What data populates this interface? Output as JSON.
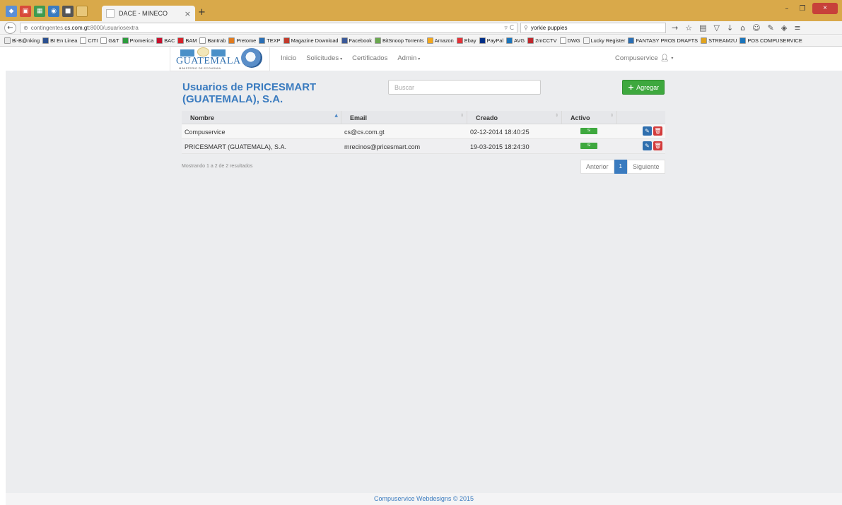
{
  "browser": {
    "tab_title": "DACE - MINECO",
    "tab_close": "×",
    "new_tab": "+",
    "url_prefix": "contingentes.",
    "url_host": "cs.com.gt",
    "url_path": ":8000/usuariosextra",
    "search_value": "yorkie puppies",
    "window_buttons": [
      "–",
      "❐",
      "×"
    ],
    "bookmarks": [
      {
        "label": "Bi-B@nking",
        "color": "#e8e8e8"
      },
      {
        "label": "BI En Linea",
        "color": "#2a4f8f"
      },
      {
        "label": "CITI",
        "color": "#ffffff"
      },
      {
        "label": "G&T",
        "color": "#ffffff"
      },
      {
        "label": "Promerica",
        "color": "#2c9b3c"
      },
      {
        "label": "BAC",
        "color": "#c8102e"
      },
      {
        "label": "BAM",
        "color": "#d6232b"
      },
      {
        "label": "Bantrab",
        "color": "#ffffff"
      },
      {
        "label": "Pretome",
        "color": "#e07b1f"
      },
      {
        "label": "TEXP",
        "color": "#2a6fb5"
      },
      {
        "label": "Magazine Download",
        "color": "#c23a2b"
      },
      {
        "label": "Facebook",
        "color": "#3b5998"
      },
      {
        "label": "BitSnoop Torrents",
        "color": "#6aa84f"
      },
      {
        "label": "Amazon",
        "color": "#f4a81d"
      },
      {
        "label": "Ebay",
        "color": "#e53238"
      },
      {
        "label": "PayPal",
        "color": "#003087"
      },
      {
        "label": "AVG",
        "color": "#1b75bb"
      },
      {
        "label": "2mCCTV",
        "color": "#c0282d"
      },
      {
        "label": "DWG",
        "color": "#ffffff"
      },
      {
        "label": "Lucky Register",
        "color": "#f3f3f3"
      },
      {
        "label": "FANTASY PROS DRAFTS",
        "color": "#2a6fb5"
      },
      {
        "label": "STREAM2U",
        "color": "#e0a31f"
      },
      {
        "label": "POS COMPUSERVICE",
        "color": "#1b75bb"
      }
    ]
  },
  "header": {
    "logo_text": "GUATEMALA",
    "logo_sub": "MINISTERIO DE ECONOMIA",
    "nav": [
      {
        "label": "Inicio",
        "caret": ""
      },
      {
        "label": "Solicitudes",
        "caret": "▾"
      },
      {
        "label": "Certificados",
        "caret": ""
      },
      {
        "label": "Admin",
        "caret": "▾"
      }
    ],
    "user": "Compuservice"
  },
  "main": {
    "title": "Usuarios de PRICESMART (GUATEMALA), S.A.",
    "search_placeholder": "Buscar",
    "add_button": "Agregar",
    "table": {
      "columns": [
        "Nombre",
        "Email",
        "Creado",
        "Activo"
      ],
      "rows": [
        {
          "nombre": "Compuservice",
          "email": "cs@cs.com.gt",
          "creado": "02-12-2014 18:40:25",
          "activo": "Si"
        },
        {
          "nombre": "PRICESMART (GUATEMALA), S.A.",
          "email": "mrecinos@pricesmart.com",
          "creado": "19-03-2015 18:24:30",
          "activo": "Si"
        }
      ]
    },
    "result_info": "Mostrando 1 a 2 de 2 resultados",
    "pagination": {
      "prev": "Anterior",
      "current": "1",
      "next": "Siguiente"
    }
  },
  "footer": {
    "text": "Compuservice Webdesigns © 2015"
  },
  "colors": {
    "accent": "#3a7bbf",
    "success": "#3ea83e",
    "danger": "#d33b3b",
    "titlebar": "#d9a94a"
  }
}
